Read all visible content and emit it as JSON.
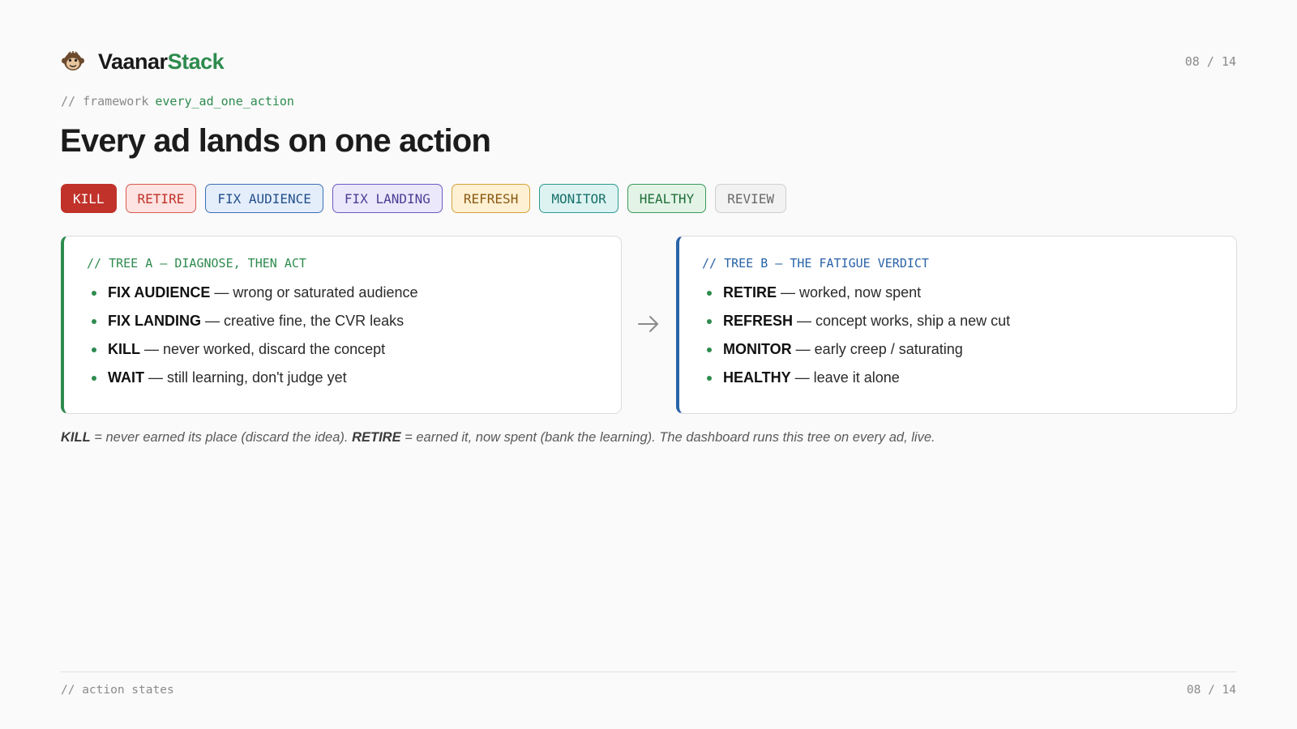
{
  "brand": {
    "name_a": "Vaanar",
    "name_b": "Stack",
    "logo_icon": "monkey-face-icon"
  },
  "page": {
    "current": "08",
    "total": "14"
  },
  "kicker": {
    "prefix": "// framework",
    "keyword": "every_ad_one_action"
  },
  "title": "Every ad lands on one action",
  "chips": [
    {
      "label": "KILL",
      "bg": "#c0322a",
      "border": "#c0322a",
      "color": "#ffffff"
    },
    {
      "label": "RETIRE",
      "bg": "#fde3e1",
      "border": "#d9574f",
      "color": "#c0322a"
    },
    {
      "label": "FIX AUDIENCE",
      "bg": "#e4eefb",
      "border": "#3b6fb6",
      "color": "#234f8a"
    },
    {
      "label": "FIX LANDING",
      "bg": "#ece8fb",
      "border": "#6a5bc2",
      "color": "#4a3e94"
    },
    {
      "label": "REFRESH",
      "bg": "#fdf0d3",
      "border": "#d3a23a",
      "color": "#8a5a12"
    },
    {
      "label": "MONITOR",
      "bg": "#ddf3f1",
      "border": "#2b9a92",
      "color": "#16706a"
    },
    {
      "label": "HEALTHY",
      "bg": "#e3f4e7",
      "border": "#3a9a58",
      "color": "#1f6e3a"
    },
    {
      "label": "REVIEW",
      "bg": "#f2f2f2",
      "border": "#cfcfcf",
      "color": "#6a6a6a"
    }
  ],
  "tree_a": {
    "label": "// TREE A — DIAGNOSE, THEN ACT",
    "items": [
      {
        "term": "FIX AUDIENCE",
        "desc": " — wrong or saturated audience"
      },
      {
        "term": "FIX LANDING",
        "desc": " — creative fine, the CVR leaks"
      },
      {
        "term": "KILL",
        "desc": " — never worked, discard the concept"
      },
      {
        "term": "WAIT",
        "desc": " — still learning, don't judge yet"
      }
    ]
  },
  "tree_b": {
    "label": "// TREE B — THE FATIGUE VERDICT",
    "items": [
      {
        "term": "RETIRE",
        "desc": " — worked, now spent"
      },
      {
        "term": "REFRESH",
        "desc": " — concept works, ship a new cut"
      },
      {
        "term": "MONITOR",
        "desc": " — early creep / saturating"
      },
      {
        "term": "HEALTHY",
        "desc": " — leave it alone"
      }
    ]
  },
  "arrow_icon": "arrow-right-icon",
  "note": {
    "kill_term": "KILL",
    "kill_text": " = never earned its place (discard the idea). ",
    "retire_term": "RETIRE",
    "retire_text": " = earned it, now spent (bank the learning). The dashboard runs this tree on every ad, live."
  },
  "footer": {
    "left": "// action states",
    "right": "08 / 14"
  }
}
